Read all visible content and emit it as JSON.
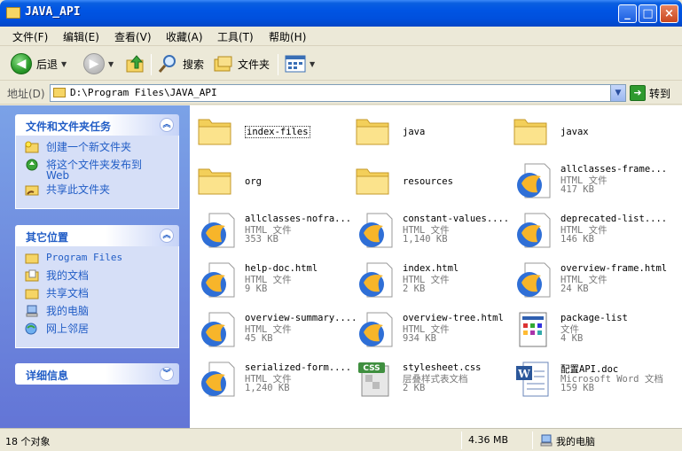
{
  "window": {
    "title": "JAVA_API",
    "controls": {
      "minimize": "_",
      "maximize": "□",
      "close": "×"
    }
  },
  "menu": [
    {
      "label": "文件(F)"
    },
    {
      "label": "编辑(E)"
    },
    {
      "label": "查看(V)"
    },
    {
      "label": "收藏(A)"
    },
    {
      "label": "工具(T)"
    },
    {
      "label": "帮助(H)"
    }
  ],
  "toolbar": {
    "back_label": "后退",
    "search_label": "搜索",
    "folders_label": "文件夹"
  },
  "address": {
    "label": "地址(D)",
    "path": "D:\\Program Files\\JAVA_API",
    "go_label": "转到"
  },
  "sidebar": {
    "tasks": {
      "title": "文件和文件夹任务",
      "items": [
        {
          "label": "创建一个新文件夹",
          "icon": "new-folder-icon"
        },
        {
          "label": "将这个文件夹发布到 Web",
          "icon": "publish-web-icon"
        },
        {
          "label": "共享此文件夹",
          "icon": "share-folder-icon"
        }
      ]
    },
    "places": {
      "title": "其它位置",
      "items": [
        {
          "label": "Program Files",
          "icon": "folder-icon"
        },
        {
          "label": "我的文档",
          "icon": "my-documents-icon"
        },
        {
          "label": "共享文档",
          "icon": "shared-documents-icon"
        },
        {
          "label": "我的电脑",
          "icon": "my-computer-icon"
        },
        {
          "label": "网上邻居",
          "icon": "network-icon"
        }
      ]
    },
    "details": {
      "title": "详细信息"
    }
  },
  "files": [
    {
      "name": "index-files",
      "kind": "folder"
    },
    {
      "name": "java",
      "kind": "folder"
    },
    {
      "name": "javax",
      "kind": "folder"
    },
    {
      "name": "org",
      "kind": "folder"
    },
    {
      "name": "resources",
      "kind": "folder"
    },
    {
      "name": "allclasses-frame...",
      "type": "HTML 文件",
      "size": "417 KB",
      "kind": "html"
    },
    {
      "name": "allclasses-nofra...",
      "type": "HTML 文件",
      "size": "353 KB",
      "kind": "html"
    },
    {
      "name": "constant-values....",
      "type": "HTML 文件",
      "size": "1,140 KB",
      "kind": "html"
    },
    {
      "name": "deprecated-list....",
      "type": "HTML 文件",
      "size": "146 KB",
      "kind": "html"
    },
    {
      "name": "help-doc.html",
      "type": "HTML 文件",
      "size": "9 KB",
      "kind": "html"
    },
    {
      "name": "index.html",
      "type": "HTML 文件",
      "size": "2 KB",
      "kind": "html"
    },
    {
      "name": "overview-frame.html",
      "type": "HTML 文件",
      "size": "24 KB",
      "kind": "html"
    },
    {
      "name": "overview-summary....",
      "type": "HTML 文件",
      "size": "45 KB",
      "kind": "html"
    },
    {
      "name": "overview-tree.html",
      "type": "HTML 文件",
      "size": "934 KB",
      "kind": "html"
    },
    {
      "name": "package-list",
      "type": "文件",
      "size": "4 KB",
      "kind": "generic"
    },
    {
      "name": "serialized-form....",
      "type": "HTML 文件",
      "size": "1,240 KB",
      "kind": "html"
    },
    {
      "name": "stylesheet.css",
      "type": "层叠样式表文档",
      "size": "2 KB",
      "kind": "css"
    },
    {
      "name": "配置API.doc",
      "type": "Microsoft Word 文档",
      "size": "159 KB",
      "kind": "doc"
    }
  ],
  "icons": {
    "css_badge": "CSS",
    "word_badge": "W"
  },
  "status": {
    "count": "18 个对象",
    "size": "4.36 MB",
    "location": "我的电脑"
  }
}
